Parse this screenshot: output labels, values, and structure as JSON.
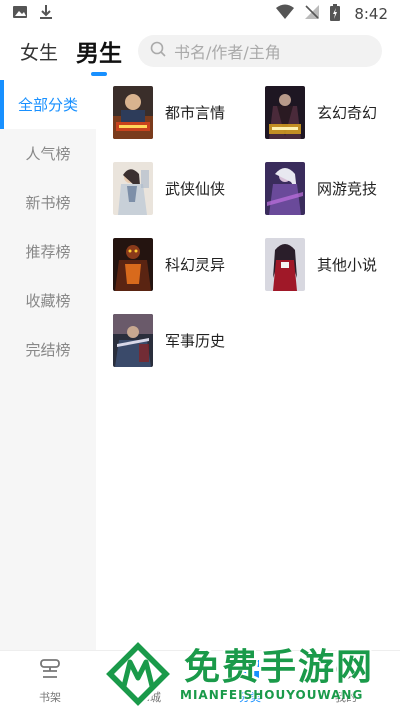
{
  "status_bar": {
    "time": "8:42"
  },
  "header": {
    "tabs": [
      {
        "label": "女生"
      },
      {
        "label": "男生"
      }
    ],
    "search": {
      "placeholder": "书名/作者/主角"
    }
  },
  "sidebar": {
    "items": [
      {
        "label": "全部分类"
      },
      {
        "label": "人气榜"
      },
      {
        "label": "新书榜"
      },
      {
        "label": "推荐榜"
      },
      {
        "label": "收藏榜"
      },
      {
        "label": "完结榜"
      }
    ]
  },
  "categories": [
    {
      "label": "都市言情"
    },
    {
      "label": "玄幻奇幻"
    },
    {
      "label": "武侠仙侠"
    },
    {
      "label": "网游竞技"
    },
    {
      "label": "科幻灵异"
    },
    {
      "label": "其他小说"
    },
    {
      "label": "军事历史"
    }
  ],
  "bottom_nav": {
    "items": [
      {
        "label": "书架"
      },
      {
        "label": "书城"
      },
      {
        "label": "分类"
      },
      {
        "label": "我的"
      }
    ]
  },
  "watermark": {
    "title": "免费手游网",
    "subtitle": "MIANFEISHOUYOUWANG"
  },
  "colors": {
    "accent": "#1890ff",
    "watermark": "#1a9a4a"
  }
}
